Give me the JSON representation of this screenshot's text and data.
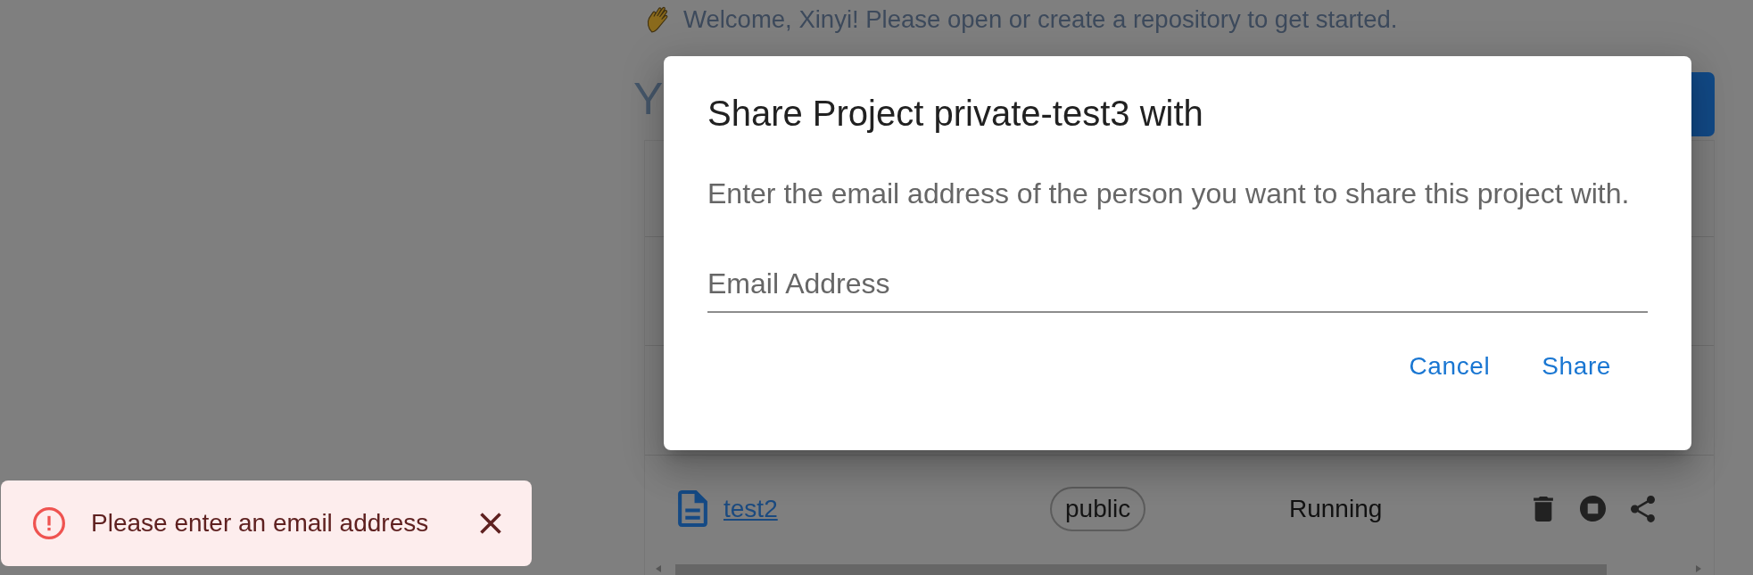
{
  "welcome": {
    "text": "Welcome, Xinyi! Please open or create a repository to get started."
  },
  "page_heading": "Y",
  "projects": [
    {
      "name": "test2",
      "visibility": "public",
      "status": "Running"
    }
  ],
  "dialog": {
    "title": "Share Project private-test3 with",
    "message": "Enter the email address of the person you want to share this project with.",
    "email_field": {
      "placeholder": "Email Address"
    },
    "buttons": [
      "Cancel",
      "Share"
    ]
  },
  "snackbar": {
    "kind": "error",
    "message": "Please enter an email address"
  }
}
